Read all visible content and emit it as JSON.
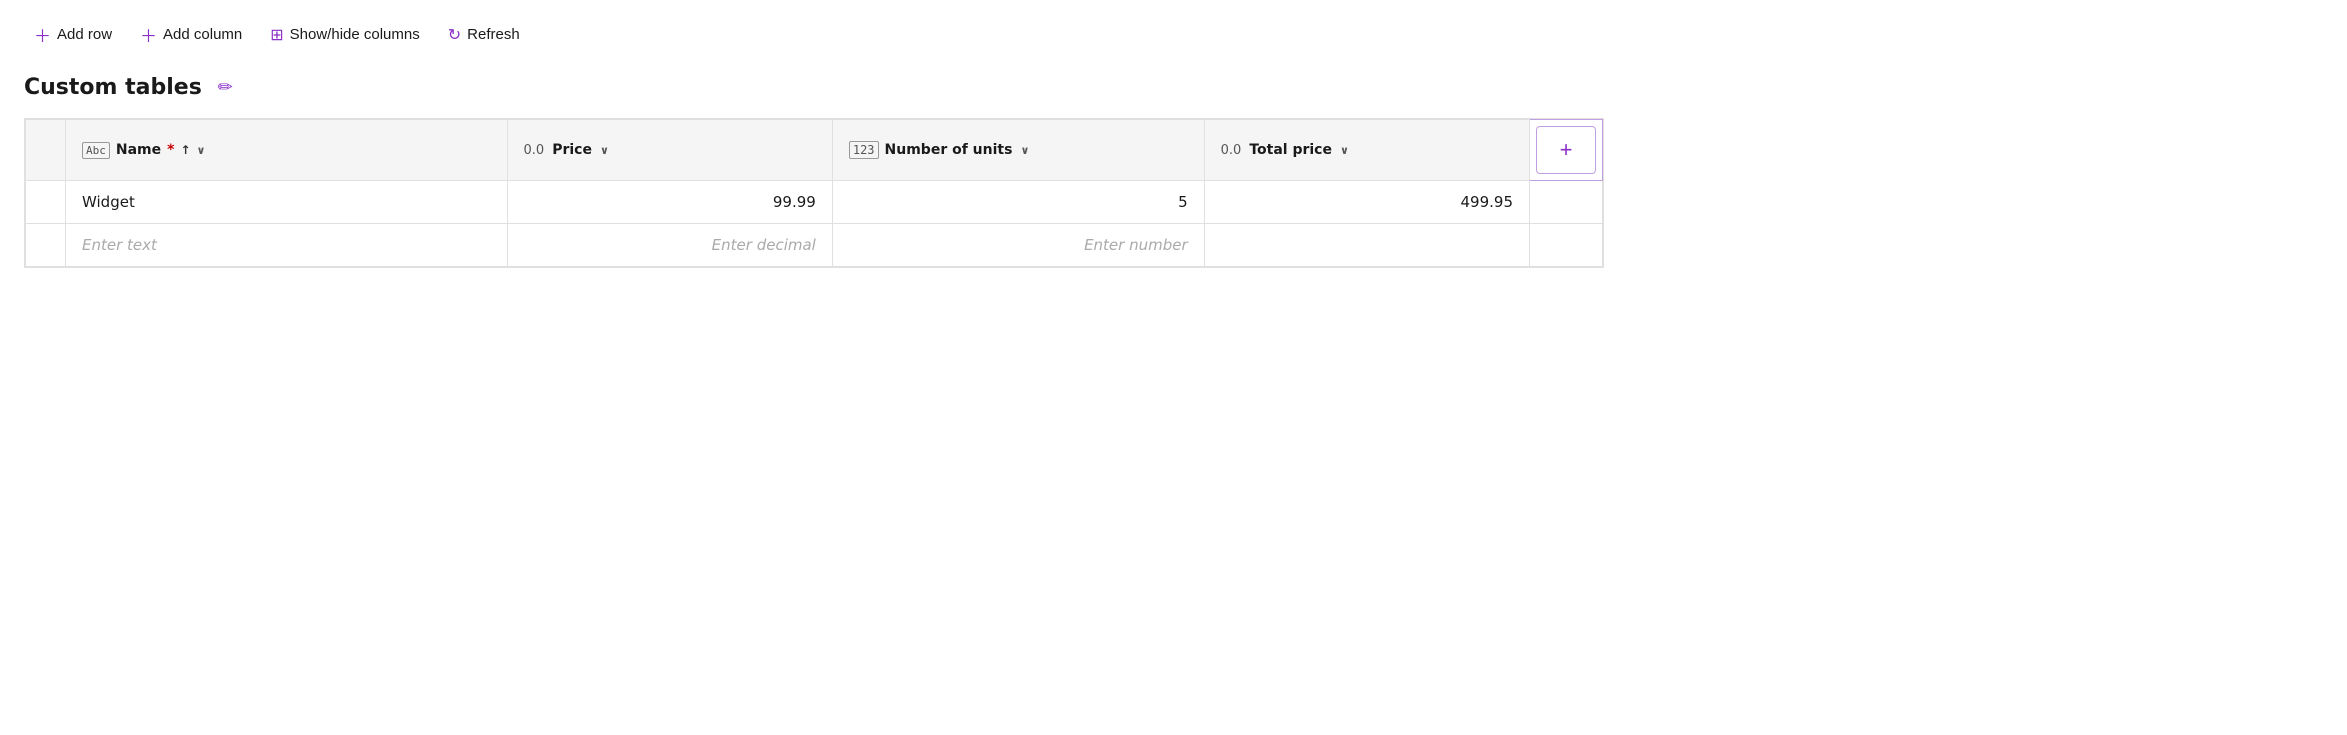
{
  "toolbar": {
    "add_row_label": "Add row",
    "add_column_label": "Add column",
    "show_hide_label": "Show/hide columns",
    "refresh_label": "Refresh"
  },
  "page": {
    "title": "Custom tables",
    "edit_tooltip": "Edit"
  },
  "table": {
    "columns": [
      {
        "id": "name",
        "icon_type": "abc",
        "label": "Name",
        "required": true,
        "sortable": true,
        "has_dropdown": false,
        "type": "text"
      },
      {
        "id": "price",
        "icon_type": "decimal",
        "icon_label": "0.0",
        "label": "Price",
        "required": false,
        "sortable": false,
        "has_dropdown": true,
        "type": "decimal"
      },
      {
        "id": "number_of_units",
        "icon_type": "number",
        "icon_label": "123",
        "label": "Number of units",
        "required": false,
        "sortable": false,
        "has_dropdown": true,
        "type": "number"
      },
      {
        "id": "total_price",
        "icon_type": "decimal",
        "icon_label": "0.0",
        "label": "Total price",
        "required": false,
        "sortable": false,
        "has_dropdown": true,
        "type": "decimal"
      }
    ],
    "rows": [
      {
        "name": "Widget",
        "price": "99.99",
        "number_of_units": "5",
        "total_price": "499.95"
      }
    ],
    "placeholders": {
      "name": "Enter text",
      "price": "Enter decimal",
      "number_of_units": "Enter number",
      "total_price": ""
    },
    "add_column_label": "+"
  }
}
